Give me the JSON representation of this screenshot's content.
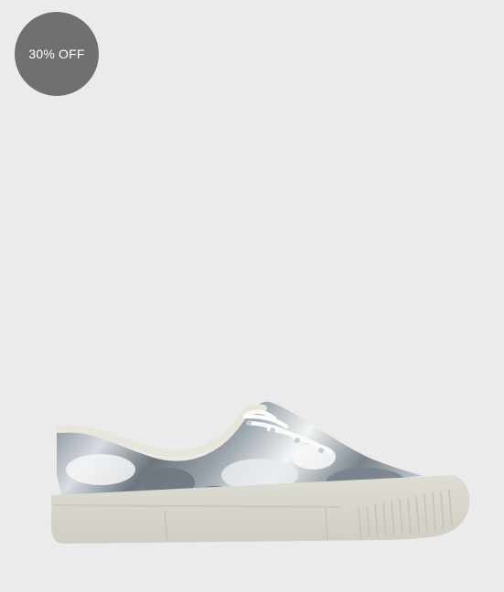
{
  "product": {
    "discount_badge": "30% OFF",
    "image": {
      "icon": "sneaker-image",
      "colors": {
        "background": "#ebebeb",
        "sole": "#d8d6cd",
        "upper_dark": "#6f7780",
        "upper_light": "#e9ecef",
        "badge": "#707070"
      }
    }
  }
}
